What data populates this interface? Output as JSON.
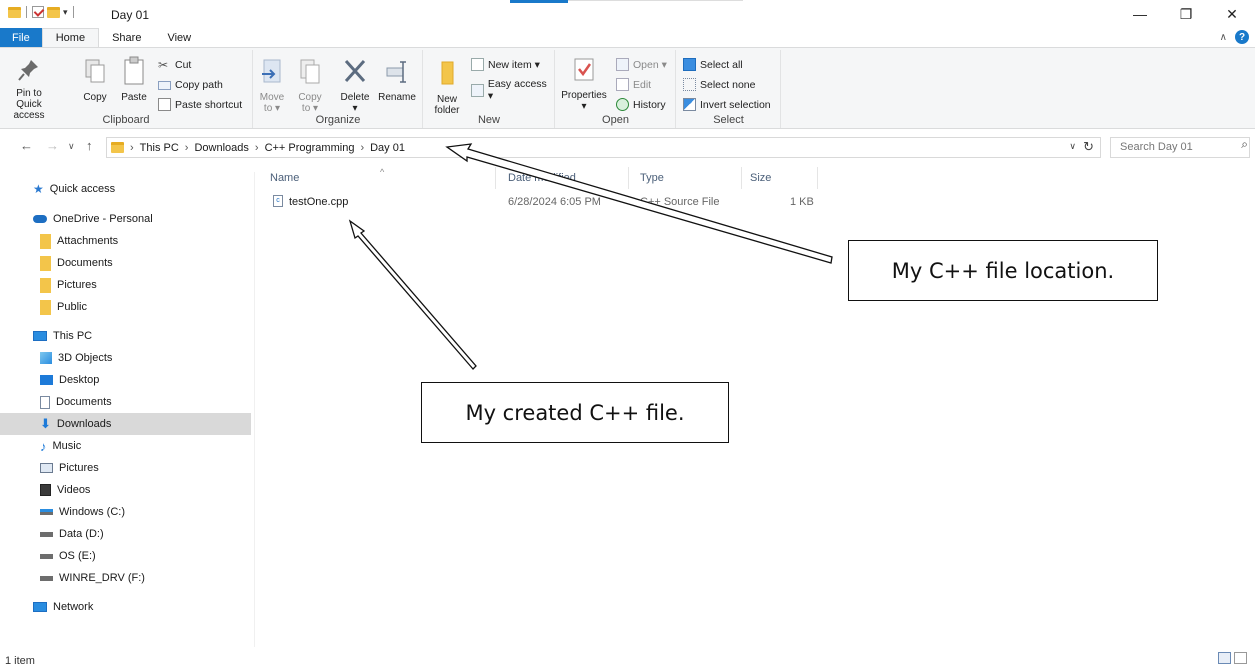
{
  "window": {
    "title": "Day 01",
    "minimize": "—",
    "maximize": "❐",
    "close": "✕"
  },
  "tabs": [
    "File",
    "Home",
    "Share",
    "View"
  ],
  "ribbon": {
    "clipboard": {
      "label": "Clipboard",
      "pin": "Pin to Quick\naccess",
      "copy": "Copy",
      "paste": "Paste",
      "cut": "Cut",
      "copy_path": "Copy path",
      "paste_shortcut": "Paste shortcut"
    },
    "organize": {
      "label": "Organize",
      "move_to": "Move\nto ▾",
      "copy_to": "Copy\nto ▾",
      "delete": "Delete\n▾",
      "rename": "Rename"
    },
    "new": {
      "label": "New",
      "new_folder": "New\nfolder",
      "new_item": "New item ▾",
      "easy_access": "Easy access ▾"
    },
    "open": {
      "label": "Open",
      "properties": "Properties\n▾",
      "open": "Open ▾",
      "edit": "Edit",
      "history": "History"
    },
    "select": {
      "label": "Select",
      "select_all": "Select all",
      "select_none": "Select none",
      "invert": "Invert selection"
    }
  },
  "address": {
    "crumbs": [
      "This PC",
      "Downloads",
      "C++ Programming",
      "Day 01"
    ],
    "search_placeholder": "Search Day 01"
  },
  "sidebar": {
    "items": [
      {
        "label": "Quick access",
        "icon": "star-icon"
      },
      {
        "label": "OneDrive - Personal",
        "icon": "cloud-icon"
      },
      {
        "label": "Attachments",
        "icon": "folder-icon"
      },
      {
        "label": "Documents",
        "icon": "folder-icon"
      },
      {
        "label": "Pictures",
        "icon": "folder-icon"
      },
      {
        "label": "Public",
        "icon": "folder-icon"
      },
      {
        "label": "This PC",
        "icon": "computer-icon"
      },
      {
        "label": "3D Objects",
        "icon": "cube-icon"
      },
      {
        "label": "Desktop",
        "icon": "desktop-icon"
      },
      {
        "label": "Documents",
        "icon": "document-icon"
      },
      {
        "label": "Downloads",
        "icon": "download-icon"
      },
      {
        "label": "Music",
        "icon": "music-icon"
      },
      {
        "label": "Pictures",
        "icon": "pictures-icon"
      },
      {
        "label": "Videos",
        "icon": "video-icon"
      },
      {
        "label": "Windows (C:)",
        "icon": "drive-icon"
      },
      {
        "label": "Data (D:)",
        "icon": "drive-icon"
      },
      {
        "label": "OS (E:)",
        "icon": "drive-icon"
      },
      {
        "label": "WINRE_DRV (F:)",
        "icon": "drive-icon"
      },
      {
        "label": "Network",
        "icon": "network-icon"
      }
    ],
    "selected": "Downloads"
  },
  "columns": {
    "name": "Name",
    "date": "Date modified",
    "type": "Type",
    "size": "Size"
  },
  "files": [
    {
      "name": "testOne.cpp",
      "date": "6/28/2024 6:05 PM",
      "type": "C++ Source File",
      "size": "1 KB"
    }
  ],
  "status": {
    "count": "1 item"
  },
  "annotations": {
    "location": "My C++ file location.",
    "created": "My created C++ file."
  },
  "colors": {
    "accent": "#1979ca",
    "folder": "#f3c54a"
  }
}
